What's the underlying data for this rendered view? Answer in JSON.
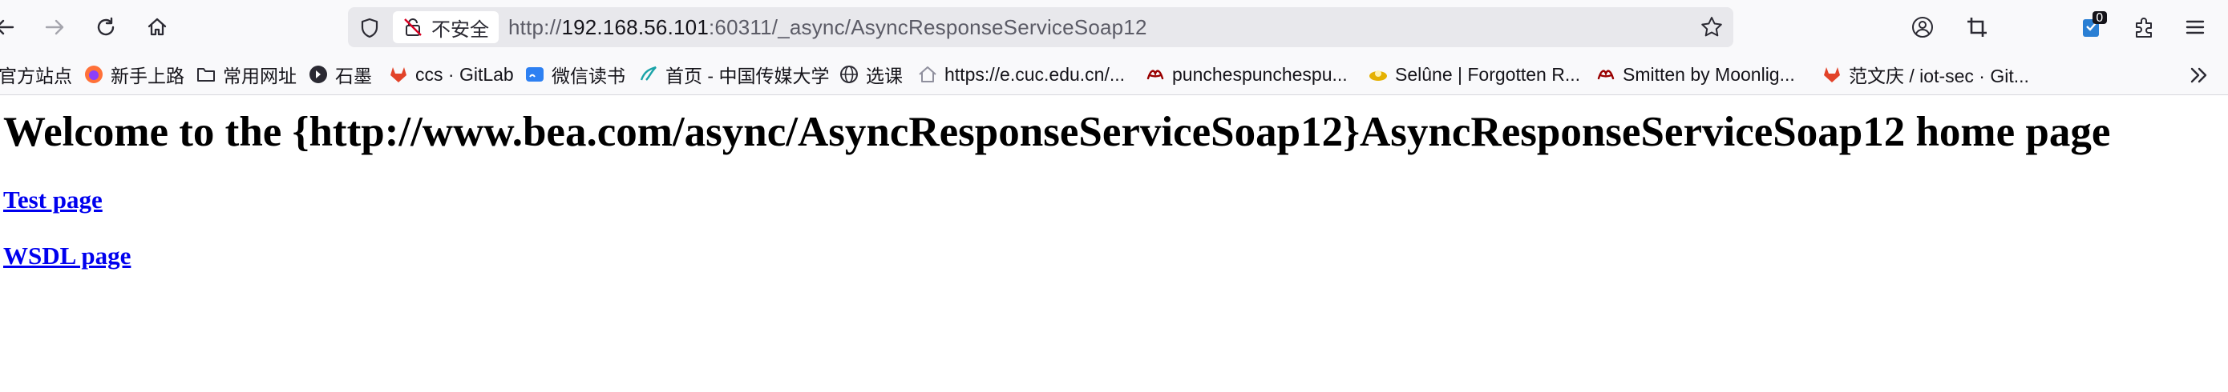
{
  "browser": {
    "security_label": "不安全",
    "url_prefix": "http://",
    "url_host": "192.168.56.101",
    "url_rest": ":60311/_async/AsyncResponseServiceSoap12",
    "extension_badge": "0",
    "icons": [
      "back-icon",
      "forward-icon",
      "reload-icon",
      "home-icon",
      "shield-icon",
      "insecure-lock-icon",
      "star-icon",
      "account-icon",
      "screenshot-crop-icon",
      "extension-icon",
      "extensions-puzzle-icon",
      "menu-icon",
      "chevron-double-right-icon"
    ]
  },
  "bookmarks": [
    {
      "label": "官方站点",
      "icon": "none"
    },
    {
      "label": "新手上路",
      "icon": "firefox-icon"
    },
    {
      "label": "常用网址",
      "icon": "folder-icon"
    },
    {
      "label": "石墨",
      "icon": "shimo-icon"
    },
    {
      "label": "ccs · GitLab",
      "icon": "gitlab-icon"
    },
    {
      "label": "微信读书",
      "icon": "weread-icon"
    },
    {
      "label": "首页 - 中国传媒大学",
      "icon": "cuc-icon"
    },
    {
      "label": "选课",
      "icon": "globe-icon"
    },
    {
      "label": "https://e.cuc.edu.cn/...",
      "icon": "house-icon"
    },
    {
      "label": "punchespunchespu...",
      "icon": "ao3-icon"
    },
    {
      "label": "Selûne | Forgotten R...",
      "icon": "selune-icon"
    },
    {
      "label": "Smitten by Moonlig...",
      "icon": "ao3-icon"
    },
    {
      "label": "范文庆 / iot-sec · Git...",
      "icon": "gitlab-icon"
    }
  ],
  "page": {
    "heading": "Welcome to the {http://www.bea.com/async/AsyncResponseServiceSoap12}AsyncResponseServiceSoap12 home page",
    "links": [
      {
        "label": "Test page"
      },
      {
        "label": "WSDL page"
      }
    ]
  },
  "colors": {
    "toolbar_bg": "#f9f9fb",
    "urlbar_bg": "#e8e8ec",
    "link": "#0000ee",
    "gitlab": "#e24329",
    "ao3": "#990000"
  }
}
